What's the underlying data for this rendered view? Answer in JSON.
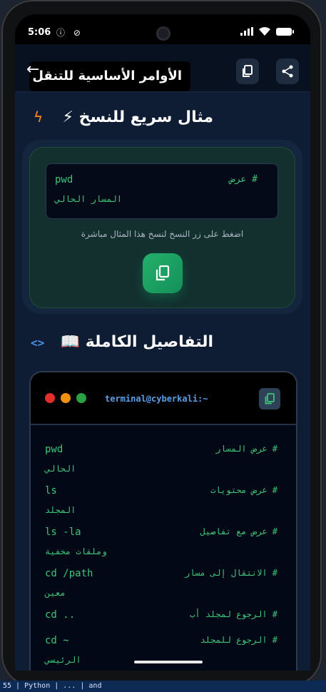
{
  "status_bar": {
    "time": "5:06",
    "left_icons": "ⓘ ⊘"
  },
  "app_bar": {
    "title": "الأوامر الأساسية للتنقل",
    "back_glyph": "←"
  },
  "quick": {
    "heading": "مثال سريع للنسخ ⚡",
    "command": "pwd",
    "comment": "# عرض",
    "comment_wrap": "المسار الحالي",
    "hint": "اضغط على زر النسخ لنسخ هذا المثال مباشرة"
  },
  "details": {
    "heading": "التفاصيل الكاملة 📖",
    "code_icon": "<>"
  },
  "terminal": {
    "title": "terminal@cyberkali:~",
    "dot_colors": [
      "#e02e2a",
      "#f2910f",
      "#2aa243"
    ],
    "lines": [
      {
        "cmd": "pwd",
        "desc": "# عرض المسار",
        "wrap": "الحالي"
      },
      {
        "cmd": "ls",
        "desc": "# عرض محتويات",
        "wrap": "المجلد"
      },
      {
        "cmd": "ls -la",
        "desc": "# عرض مع تفاصيل",
        "wrap": "وملفات مخفية"
      },
      {
        "cmd": "cd /path",
        "desc": "# الانتقال إلى مسار",
        "wrap": "معين"
      },
      {
        "cmd": "cd ..",
        "desc": "# الرجوع لمجلد أب",
        "wrap": ""
      },
      {
        "cmd": "cd ~",
        "desc": "# الرجوع للمجلد",
        "wrap": "الرئيسي"
      }
    ]
  },
  "bottom_strip": "55 | Python | ... | and"
}
